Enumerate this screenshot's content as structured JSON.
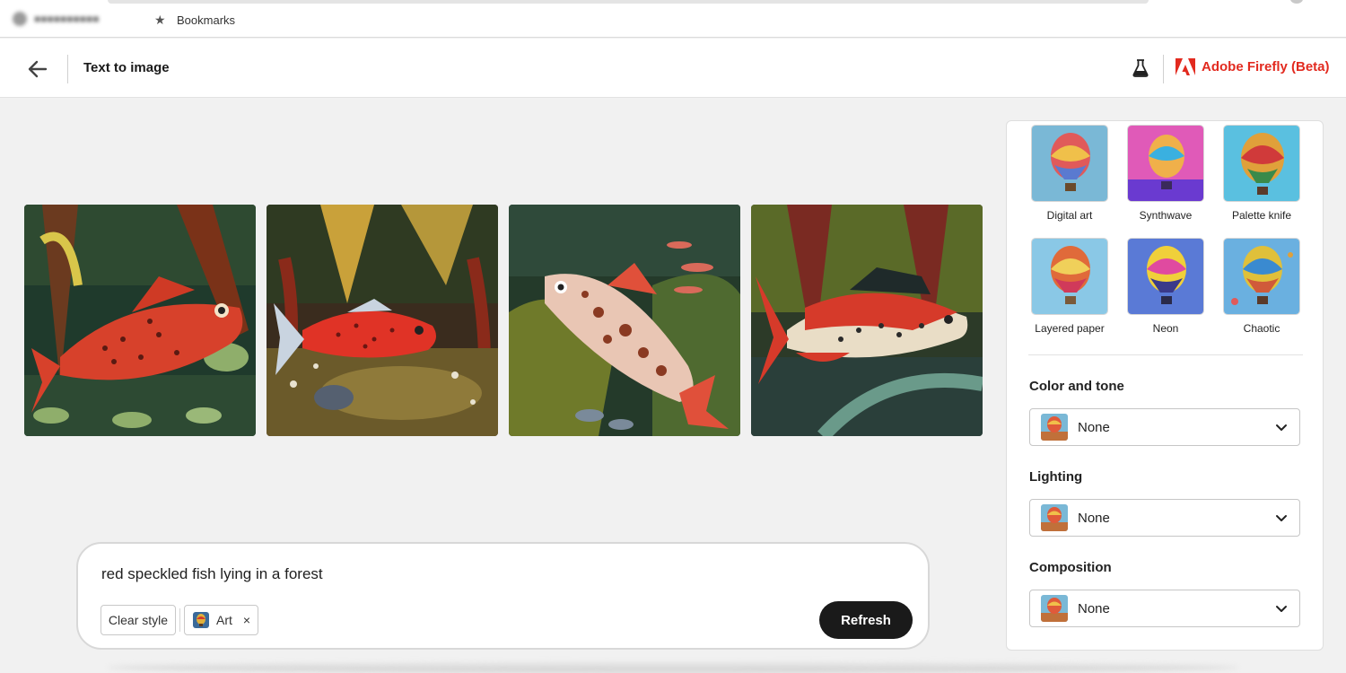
{
  "browser": {
    "bookmarks_label": "Bookmarks",
    "icons": {
      "star": "star-icon"
    }
  },
  "header": {
    "title": "Text to image",
    "brand": "Adobe Firefly (Beta)",
    "brand_color": "#e22a1f",
    "icons": {
      "back": "arrow-left-icon",
      "labs": "flask-icon",
      "logo": "adobe-logo-icon"
    }
  },
  "results": [
    {
      "name": "fish-image-1"
    },
    {
      "name": "fish-image-2"
    },
    {
      "name": "fish-image-3"
    },
    {
      "name": "fish-image-4"
    }
  ],
  "prompt": {
    "text": "red speckled fish lying in a forest",
    "clear_style_label": "Clear style",
    "style_chip_label": "Art",
    "remove_icon": "×",
    "refresh_label": "Refresh"
  },
  "styles_panel": {
    "tiles": [
      {
        "label": "Digital art"
      },
      {
        "label": "Synthwave"
      },
      {
        "label": "Palette knife"
      },
      {
        "label": "Layered paper"
      },
      {
        "label": "Neon"
      },
      {
        "label": "Chaotic"
      }
    ],
    "color_and_tone": {
      "title": "Color and tone",
      "value": "None"
    },
    "lighting": {
      "title": "Lighting",
      "value": "None"
    },
    "composition": {
      "title": "Composition",
      "value": "None"
    }
  }
}
